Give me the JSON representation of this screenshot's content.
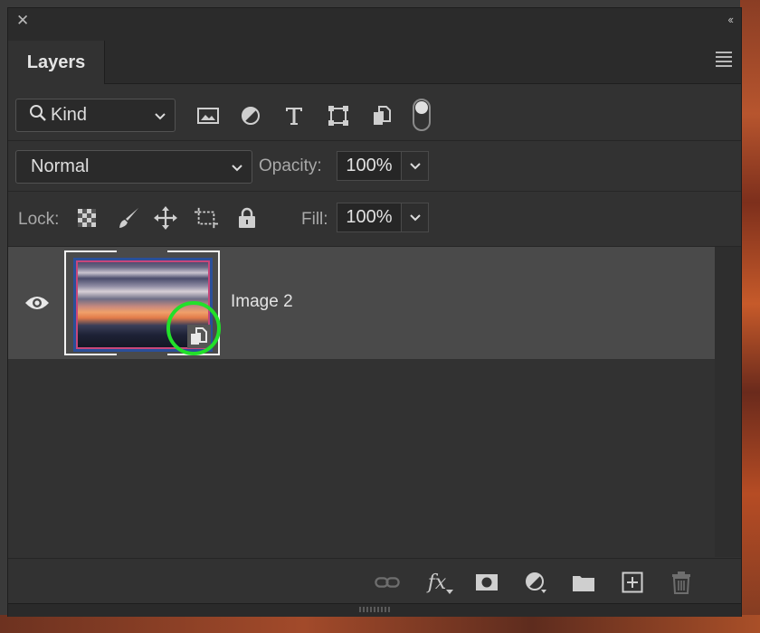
{
  "panel": {
    "tab_label": "Layers",
    "colors": {
      "panel_bg": "#323232",
      "selected_row": "#4a4a4a",
      "highlight_ring": "#22e02a"
    }
  },
  "filter": {
    "kind_label": "Kind",
    "icons": [
      "image-filter-icon",
      "adjustment-filter-icon",
      "type-filter-icon",
      "shape-filter-icon",
      "smart-object-filter-icon"
    ]
  },
  "blending": {
    "mode": "Normal",
    "opacity_label": "Opacity:",
    "opacity_value": "100%"
  },
  "lock": {
    "label": "Lock:",
    "icons": [
      "lock-transparency-icon",
      "lock-pixels-icon",
      "lock-position-icon",
      "lock-artboard-icon",
      "lock-all-icon"
    ],
    "fill_label": "Fill:",
    "fill_value": "100%"
  },
  "layers": [
    {
      "name": "Image 2",
      "visible": true,
      "type": "smart-object",
      "selected": true
    }
  ],
  "footer_icons": [
    "link-icon",
    "fx-icon",
    "mask-icon",
    "adjustment-layer-icon",
    "group-folder-icon",
    "new-layer-icon",
    "trash-icon"
  ],
  "footer_fx_text": "fx"
}
